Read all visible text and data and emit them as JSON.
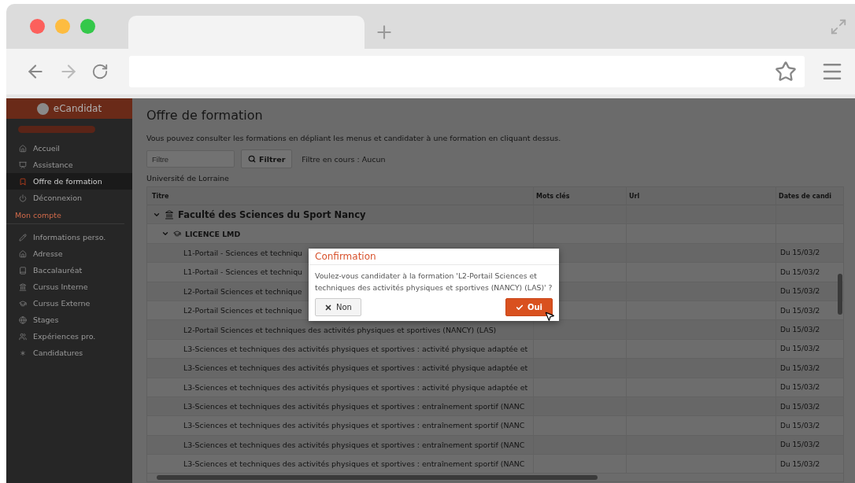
{
  "sidebar": {
    "app_name": "eCandidat",
    "items": [
      {
        "kind": "link",
        "label": "Accueil",
        "selected": false
      },
      {
        "kind": "link",
        "label": "Assistance",
        "selected": false
      },
      {
        "kind": "link",
        "label": "Offre de formation",
        "selected": true
      },
      {
        "kind": "link",
        "label": "Déconnexion",
        "selected": false
      },
      {
        "kind": "section",
        "label": "Mon compte"
      },
      {
        "kind": "link",
        "label": "Informations perso.",
        "selected": false
      },
      {
        "kind": "link",
        "label": "Adresse",
        "selected": false
      },
      {
        "kind": "link",
        "label": "Baccalauréat",
        "selected": false
      },
      {
        "kind": "link",
        "label": "Cursus Interne",
        "selected": false
      },
      {
        "kind": "link",
        "label": "Cursus Externe",
        "selected": false
      },
      {
        "kind": "link",
        "label": "Stages",
        "selected": false
      },
      {
        "kind": "link",
        "label": "Expériences pro.",
        "selected": false
      },
      {
        "kind": "link",
        "label": "Candidatures",
        "selected": false
      }
    ]
  },
  "main": {
    "title": "Offre de formation",
    "intro": "Vous pouvez consulter les formations en dépliant les menus et candidater à une formation en cliquant dessus.",
    "filter": {
      "placeholder": "Filtre",
      "button": "Filtrer",
      "status": "Filtre en cours : Aucun"
    },
    "university": "Université de Lorraine",
    "table": {
      "columns": [
        "Titre",
        "Mots clés",
        "Url",
        "Dates de candi"
      ],
      "rows": [
        {
          "title": "Faculté des Sciences du Sport Nancy",
          "expanded": true,
          "children": [
            {
              "title": "LICENCE LMD",
              "expanded": true,
              "children": [
                {
                  "title": "L1-Portail - Sciences et techniqu",
                  "dates": "Du 15/03/2"
                },
                {
                  "title": "L1-Portail - Sciences et techniqu",
                  "dates": "Du 15/03/2"
                },
                {
                  "title": "L2-Portail Sciences et technique",
                  "dates": "Du 15/03/2"
                },
                {
                  "title": "L2-Portail Sciences et technique",
                  "dates": "Du 15/03/2"
                },
                {
                  "title": "L2-Portail Sciences et techniques des activités physiques et sportives (NANCY) (LAS)",
                  "dates": "Du 15/03/2"
                },
                {
                  "title": "L3-Sciences et techniques des activités physiques et sportives : activité physique adaptée et",
                  "dates": "Du 15/03/2"
                },
                {
                  "title": "L3-Sciences et techniques des activités physiques et sportives : activité physique adaptée et",
                  "dates": "Du 15/03/2"
                },
                {
                  "title": "L3-Sciences et techniques des activités physiques et sportives : activité physique adaptée et",
                  "dates": "Du 15/03/2"
                },
                {
                  "title": "L3-Sciences et techniques des activités physiques et sportives : entraînement sportif (NANC",
                  "dates": "Du 15/03/2"
                },
                {
                  "title": "L3-Sciences et techniques des activités physiques et sportives : entraînement sportif (NANC",
                  "dates": "Du 15/03/2"
                },
                {
                  "title": "L3-Sciences et techniques des activités physiques et sportives : entraînement sportif (NANC",
                  "dates": "Du 15/03/2"
                },
                {
                  "title": "L3-Sciences et techniques des activités physiques et sportives : entraînement sportif (NANC",
                  "dates": "Du 15/03/2"
                }
              ]
            }
          ]
        }
      ]
    }
  },
  "dialog": {
    "title": "Confirmation",
    "message": "Voulez-vous candidater à la formation 'L2-Portail Sciences et techniques des activités physiques et sportives (NANCY) (LAS)' ?",
    "buttons": [
      {
        "kind": "cancel",
        "label": "Non"
      },
      {
        "kind": "confirm",
        "label": "Oui"
      }
    ]
  }
}
